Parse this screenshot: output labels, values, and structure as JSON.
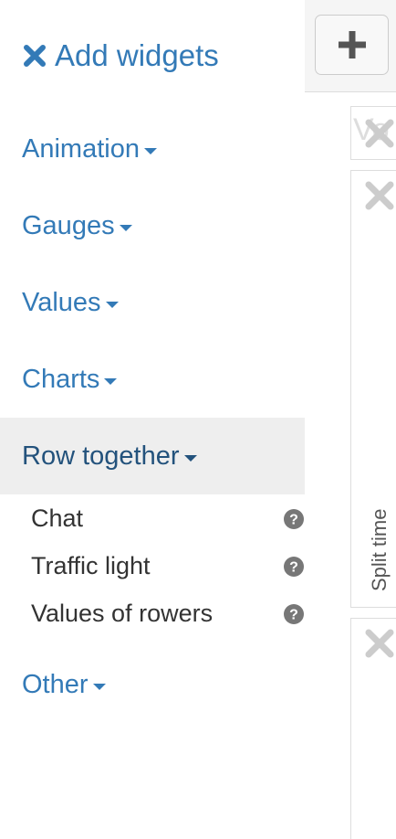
{
  "sidebar": {
    "header": {
      "label": "Add widgets",
      "icon": "close-icon"
    },
    "categories": [
      {
        "label": "Animation"
      },
      {
        "label": "Gauges"
      },
      {
        "label": "Values"
      },
      {
        "label": "Charts"
      },
      {
        "label": "Row together",
        "expanded": true
      },
      {
        "label": "Other"
      }
    ],
    "row_together_items": [
      {
        "label": "Chat",
        "icon": "help-icon"
      },
      {
        "label": "Traffic light",
        "icon": "help-icon"
      },
      {
        "label": "Values of rowers",
        "icon": "help-icon"
      }
    ]
  },
  "canvas": {
    "add_button_icon": "plus-icon",
    "widgets": [
      {
        "partial_title": "Vo",
        "close_icon": "close-icon"
      },
      {
        "vertical_label": "Split time",
        "close_icon": "close-icon"
      },
      {
        "close_icon": "close-icon"
      }
    ]
  },
  "colors": {
    "link": "#337ab7",
    "link_active": "#23527c",
    "active_bg": "#eeeeee",
    "help_icon": "#777777",
    "close_icon": "#cccccc"
  }
}
